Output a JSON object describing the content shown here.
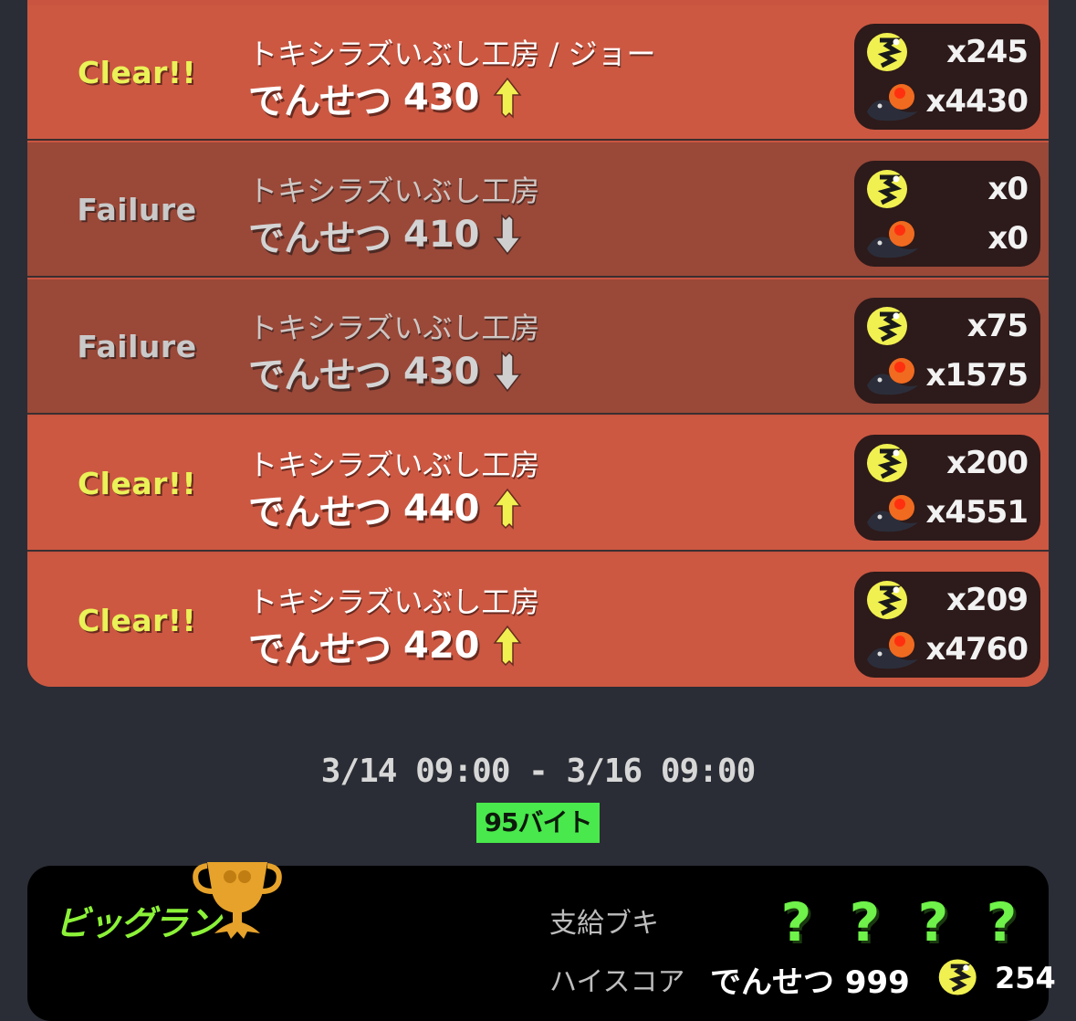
{
  "shifts": [
    {
      "status": "Clear!!",
      "result": "clear",
      "stage": "トキシラズいぶし工房 / ジョー",
      "grade_name": "でんせつ",
      "grade_points": "430",
      "direction": "up",
      "golden_eggs": "x245",
      "power_eggs": "x4430"
    },
    {
      "status": "Failure",
      "result": "failure",
      "stage": "トキシラズいぶし工房",
      "grade_name": "でんせつ",
      "grade_points": "410",
      "direction": "down",
      "golden_eggs": "x0",
      "power_eggs": "x0"
    },
    {
      "status": "Failure",
      "result": "failure",
      "stage": "トキシラズいぶし工房",
      "grade_name": "でんせつ",
      "grade_points": "430",
      "direction": "down",
      "golden_eggs": "x75",
      "power_eggs": "x1575"
    },
    {
      "status": "Clear!!",
      "result": "clear",
      "stage": "トキシラズいぶし工房",
      "grade_name": "でんせつ",
      "grade_points": "440",
      "direction": "up",
      "golden_eggs": "x200",
      "power_eggs": "x4551"
    },
    {
      "status": "Clear!!",
      "result": "clear",
      "stage": "トキシラズいぶし工房",
      "grade_name": "でんせつ",
      "grade_points": "420",
      "direction": "up",
      "golden_eggs": "x209",
      "power_eggs": "x4760"
    }
  ],
  "schedule": {
    "date_range": "3/14 09:00 - 3/16 09:00",
    "shift_count": "95バイト"
  },
  "bigrun": {
    "title": "ビッグラン",
    "weapons_label": "支給ブキ",
    "weapons": [
      "?",
      "?",
      "?",
      "?"
    ],
    "highscore_label": "ハイスコア",
    "highscore_grade": "でんせつ 999",
    "highscore_golden": "254"
  },
  "colors": {
    "clear_row": "#cc5842",
    "failure_row": "#9a4838",
    "clear_text": "#eaf257",
    "up_arrow": "#f0f050",
    "down_arrow": "#cfcfcf",
    "badge": "#49e84c",
    "bigrun_title": "#8cf238"
  },
  "icons": {
    "golden_egg": "golden-egg-icon",
    "power_egg": "power-egg-icon",
    "up_arrow": "arrow-up-icon",
    "down_arrow": "arrow-down-icon",
    "trophy": "trophy-icon"
  }
}
